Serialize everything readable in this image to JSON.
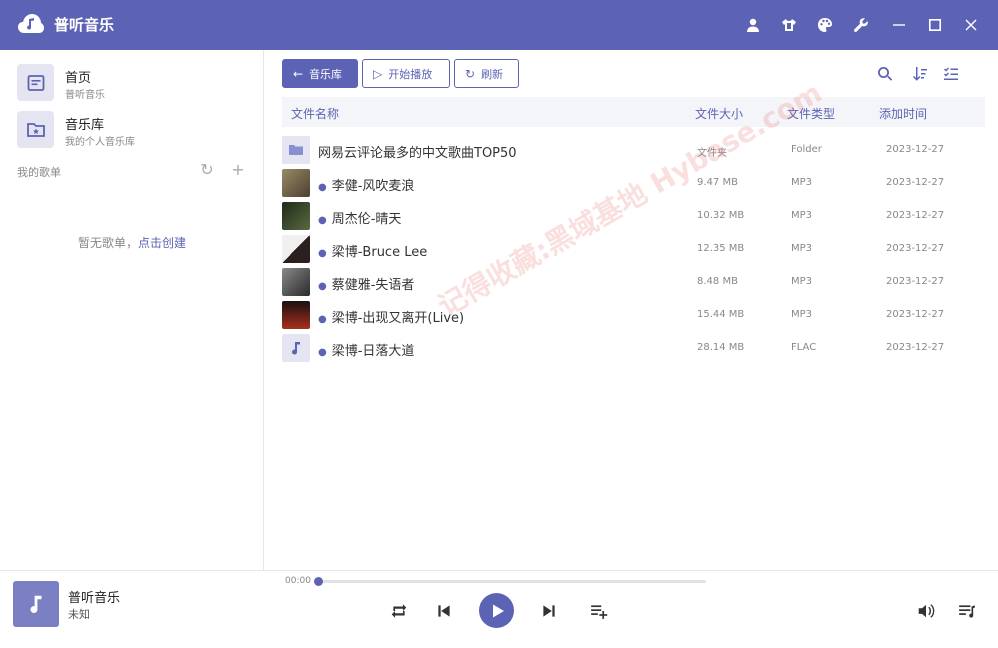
{
  "app": {
    "title": "普听音乐"
  },
  "titlebar": {
    "icons": [
      "user-icon",
      "shirt-icon",
      "palette-icon",
      "wrench-icon",
      "minimize-icon",
      "maximize-icon",
      "close-icon"
    ]
  },
  "sidebar": {
    "nav": [
      {
        "title": "首页",
        "subtitle": "普听音乐",
        "icon": "home-icon"
      },
      {
        "title": "音乐库",
        "subtitle": "我的个人音乐库",
        "icon": "library-icon"
      }
    ],
    "playlists_header": "我的歌单",
    "empty_text": "暂无歌单，",
    "empty_link": "点击创建"
  },
  "toolbar": {
    "back_label": "音乐库",
    "play_all_label": "开始播放",
    "refresh_label": "刷新"
  },
  "table": {
    "columns": {
      "name": "文件名称",
      "size": "文件大小",
      "type": "文件类型",
      "date": "添加时间"
    },
    "rows": [
      {
        "name": "网易云评论最多的中文歌曲TOP50",
        "size": "文件夹",
        "type": "Folder",
        "date": "2023-12-27",
        "kind": "folder"
      },
      {
        "name": "李健-风吹麦浪",
        "size": "9.47 MB",
        "type": "MP3",
        "date": "2023-12-27",
        "kind": "art",
        "color": "#6d6048"
      },
      {
        "name": "周杰伦-晴天",
        "size": "10.32 MB",
        "type": "MP3",
        "date": "2023-12-27",
        "kind": "art",
        "color": "#2f3a25"
      },
      {
        "name": "梁博-Bruce Lee",
        "size": "12.35 MB",
        "type": "MP3",
        "date": "2023-12-27",
        "kind": "art",
        "color": "#2a2020"
      },
      {
        "name": "蔡健雅-失语者",
        "size": "8.48 MB",
        "type": "MP3",
        "date": "2023-12-27",
        "kind": "art",
        "color": "#4a4a4a"
      },
      {
        "name": "梁博-出现又离开(Live)",
        "size": "15.44 MB",
        "type": "MP3",
        "date": "2023-12-27",
        "kind": "art",
        "color": "#5a1a14"
      },
      {
        "name": "梁博-日落大道",
        "size": "28.14 MB",
        "type": "FLAC",
        "date": "2023-12-27",
        "kind": "music"
      }
    ]
  },
  "player": {
    "title": "普听音乐",
    "artist": "未知",
    "time": "00:00",
    "progress": 0
  },
  "watermark": "记得收藏:黑域基地 Hybase.com",
  "colors": {
    "accent": "#5d63b4"
  }
}
